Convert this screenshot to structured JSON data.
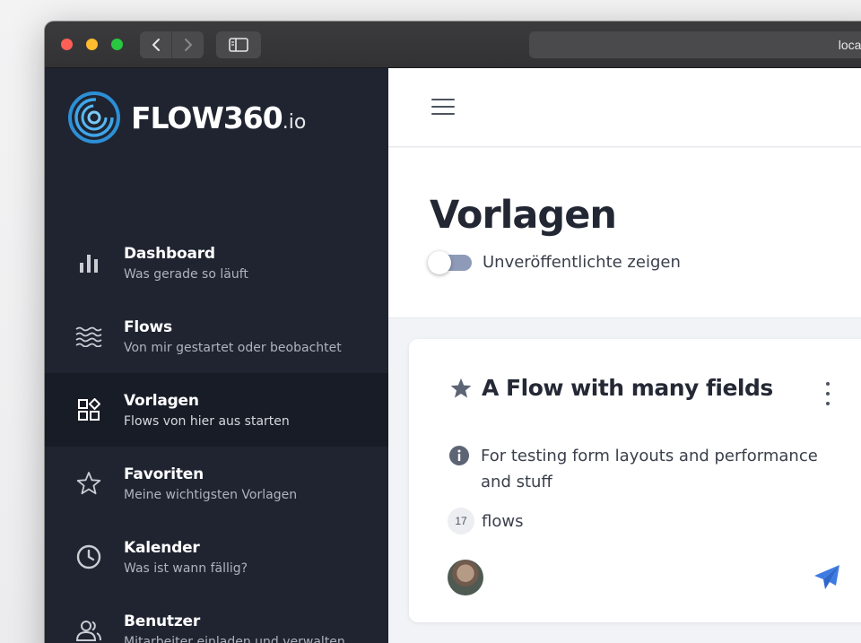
{
  "browser": {
    "url_text": "localhost"
  },
  "brand": {
    "name": "FLOW360",
    "suffix": ".io",
    "logo_icon": "concentric-rings-logo"
  },
  "sidebar": {
    "items": [
      {
        "title": "Dashboard",
        "subtitle": "Was gerade so läuft",
        "icon": "bar-chart-icon",
        "active": false
      },
      {
        "title": "Flows",
        "subtitle": "Von mir gestartet oder beobachtet",
        "icon": "waves-icon",
        "active": false
      },
      {
        "title": "Vorlagen",
        "subtitle": "Flows von hier aus starten",
        "icon": "shapes-icon",
        "active": true
      },
      {
        "title": "Favoriten",
        "subtitle": "Meine wichtigsten Vorlagen",
        "icon": "star-outline-icon",
        "active": false
      },
      {
        "title": "Kalender",
        "subtitle": "Was ist wann fällig?",
        "icon": "clock-icon",
        "active": false
      },
      {
        "title": "Benutzer",
        "subtitle": "Mitarbeiter einladen und verwalten",
        "icon": "users-icon",
        "active": false
      }
    ]
  },
  "page": {
    "title": "Vorlagen",
    "toggle_label": "Unveröffentlichte zeigen",
    "toggle_on": false
  },
  "card": {
    "title": "A Flow with many fields",
    "description": "For testing form layouts and performance and stuff",
    "flow_count": "17",
    "flow_label": "flows"
  },
  "colors": {
    "sidebar_bg": "#1f2430",
    "sidebar_active_bg": "#181c26",
    "accent": "#3d7be3",
    "text_dark": "#222733"
  }
}
